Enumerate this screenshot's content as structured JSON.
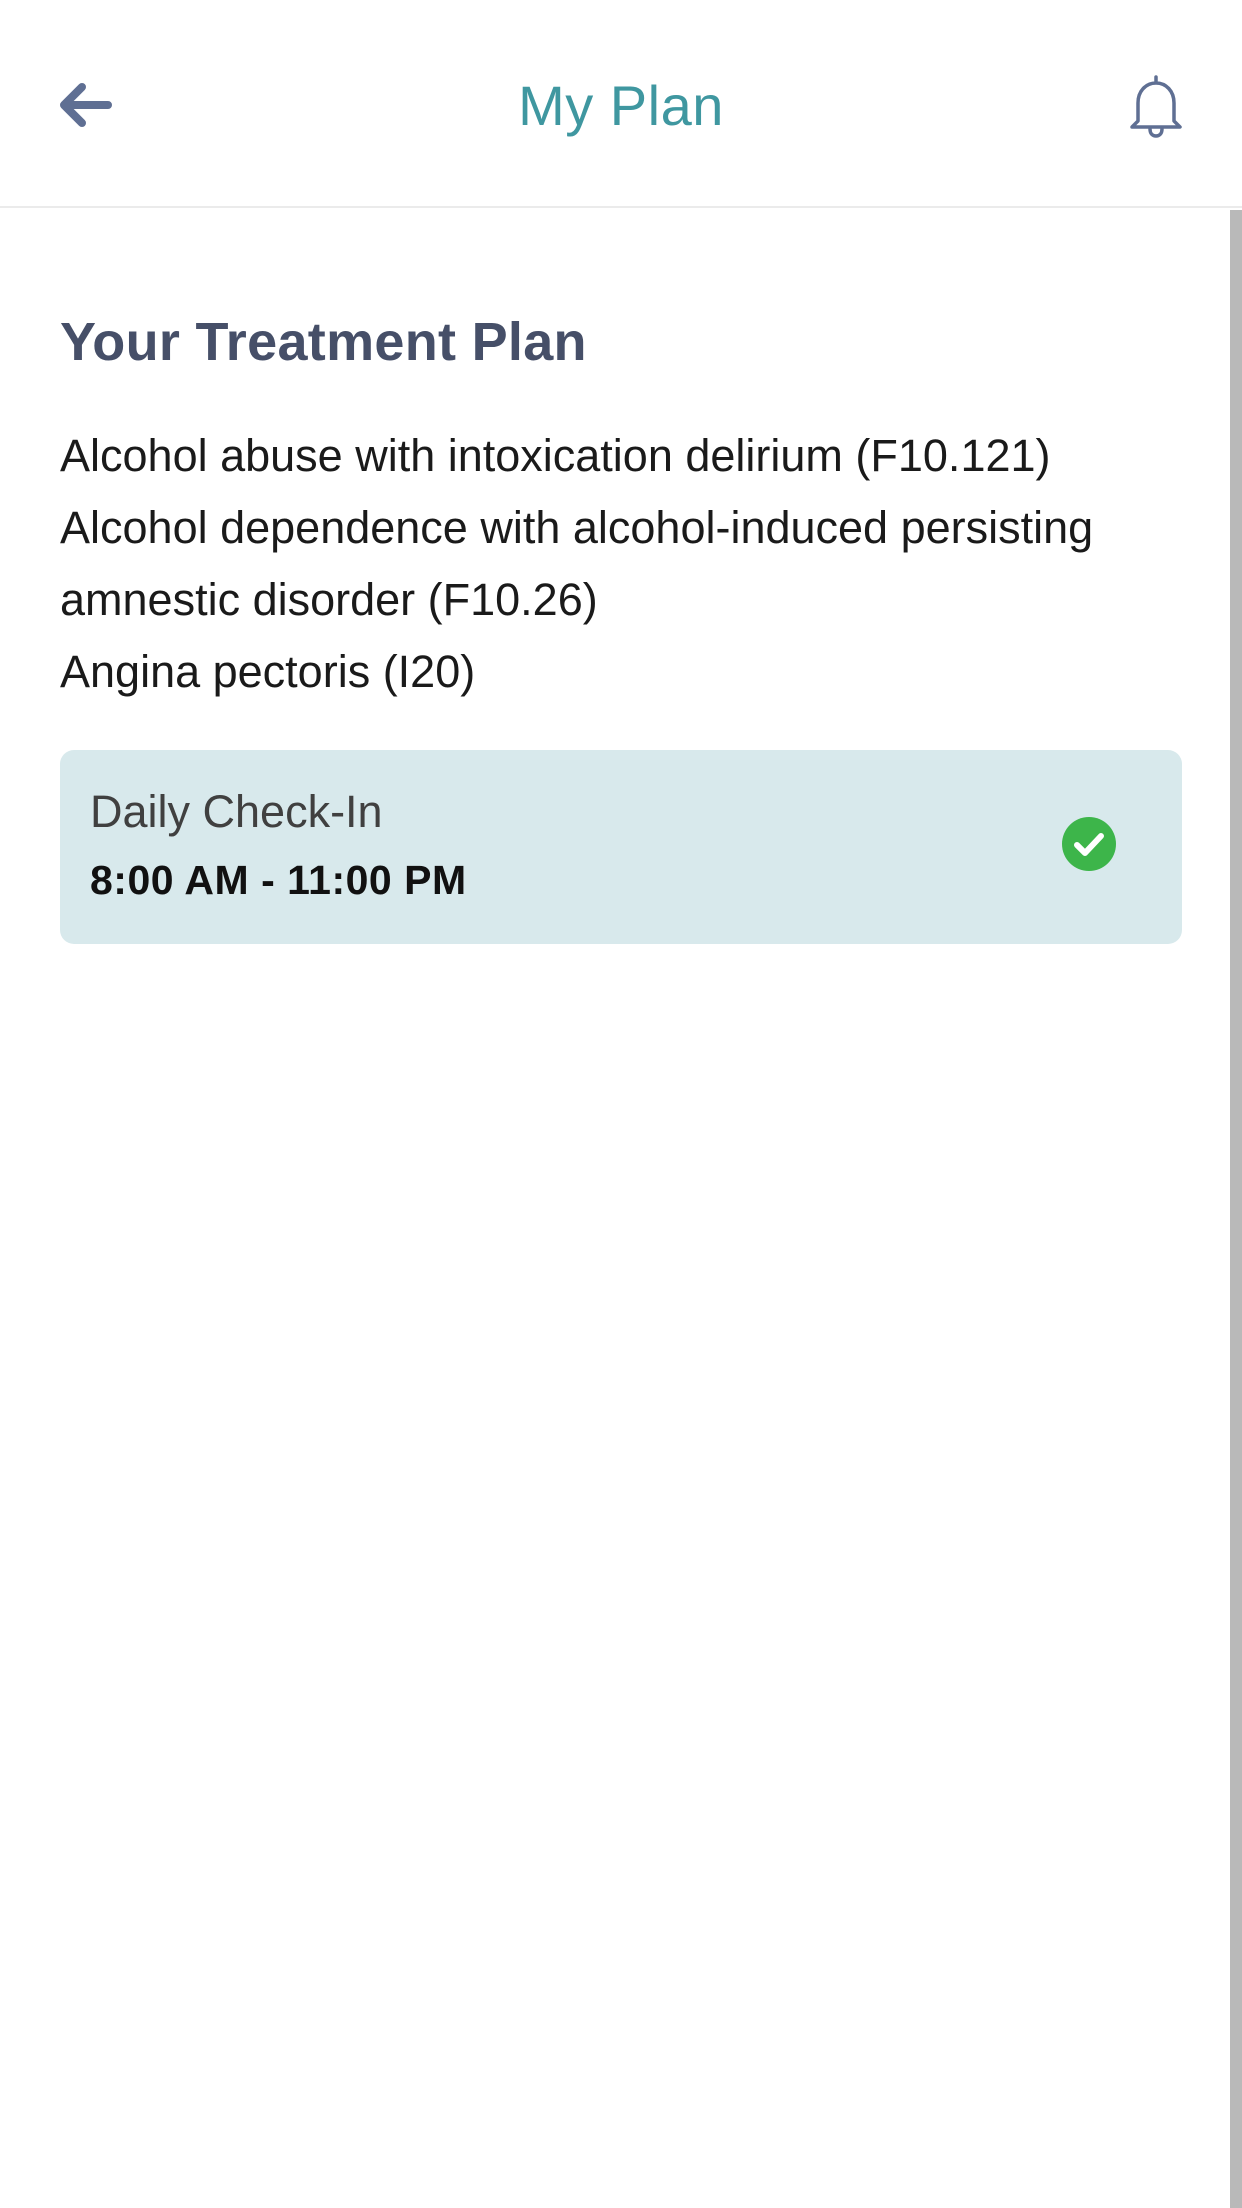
{
  "header": {
    "title": "My Plan",
    "back_icon": "back-arrow-icon",
    "notification_icon": "bell-icon",
    "title_color": "#3f97a0"
  },
  "treatment_plan": {
    "title": "Your Treatment Plan",
    "diagnoses": [
      "Alcohol abuse with intoxication delirium (F10.121)",
      "Alcohol dependence with alcohol-induced persisting amnestic disorder (F10.26)",
      "Angina pectoris (I20)"
    ]
  },
  "checkin": {
    "label": "Daily Check-In",
    "time_range": "8:00 AM - 11:00 PM",
    "status_icon": "check-circle-icon",
    "status_color": "#3db54a",
    "card_color": "#d8e9ec"
  }
}
